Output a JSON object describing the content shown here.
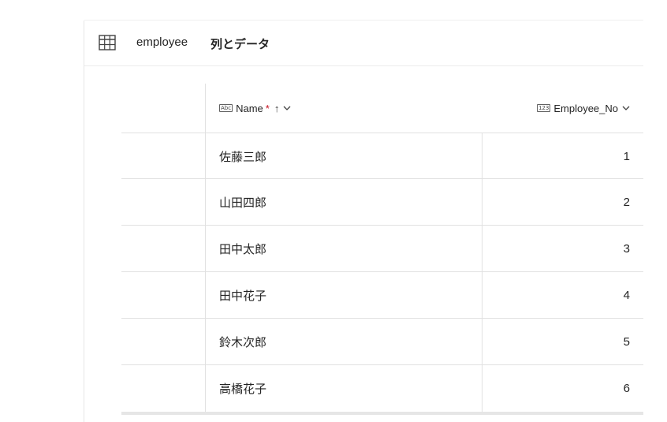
{
  "header": {
    "table_name": "employee",
    "subtitle": "列とデータ",
    "icon": "table-icon"
  },
  "columns": [
    {
      "label": "Name",
      "type_icon": "Abc",
      "required_mark": "*",
      "sort_indicator": "↑",
      "menu_icon": "chevron-down-icon"
    },
    {
      "label": "Employee_No",
      "type_icon": "123",
      "menu_icon": "chevron-down-icon"
    }
  ],
  "rows": [
    {
      "name": "佐藤三郎",
      "employee_no": "1"
    },
    {
      "name": "山田四郎",
      "employee_no": "2"
    },
    {
      "name": "田中太郎",
      "employee_no": "3"
    },
    {
      "name": "田中花子",
      "employee_no": "4"
    },
    {
      "name": "鈴木次郎",
      "employee_no": "5"
    },
    {
      "name": "高橋花子",
      "employee_no": "6"
    }
  ],
  "colors": {
    "required": "#c50f1f",
    "border": "#e1e1e1",
    "text": "#242424"
  }
}
